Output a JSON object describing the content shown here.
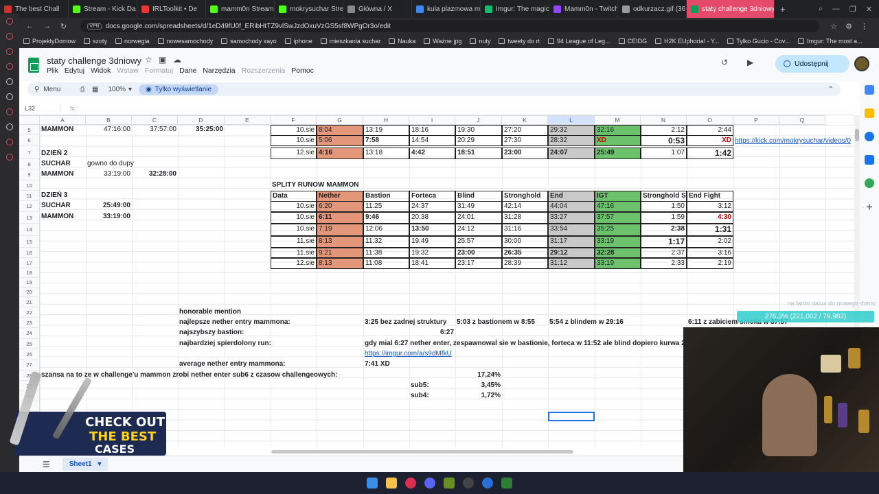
{
  "browser": {
    "tabs": [
      {
        "label": "The best Chall",
        "color": "#c33"
      },
      {
        "label": "Stream - Kick Da",
        "color": "#53fc18"
      },
      {
        "label": "IRLToolkit • De",
        "color": "#e33"
      },
      {
        "label": "mamm0n Stream",
        "color": "#53fc18"
      },
      {
        "label": "mokrysuchar Stre",
        "color": "#53fc18"
      },
      {
        "label": "Główna / X",
        "color": "#888"
      },
      {
        "label": "kula plazmowa m",
        "color": "#4285f4"
      },
      {
        "label": "Imgur: The magic",
        "color": "#1bb76e"
      },
      {
        "label": "Mamm0n - Twitch",
        "color": "#9146ff"
      },
      {
        "label": "odkurzacz.gif (36",
        "color": "#999"
      },
      {
        "label": "staty challenge 3dniowy",
        "color": "#0f9d58",
        "active": true
      }
    ],
    "new_tab": "+",
    "vpn": "VPN",
    "url": "docs.google.com/spreadsheets/d/1eD49fU0f_ERibHtTZ9vlSwJzdOxuVzGS5sf8WPgOr3o/edit",
    "bookmarks": [
      "ProjektyDomow",
      "szoty",
      "norwegia",
      "nowesamochody",
      "samochody xayo",
      "iphone",
      "mieszkania suchar",
      "Nauka",
      "Ważne jpg",
      "nuty",
      "tweety do rt",
      "94 League of Leg...",
      "CEIDG",
      "H2K EUphoria! - Y...",
      "Tylko Gucio - Cov...",
      "Imgur: The most a..."
    ]
  },
  "doc": {
    "title": "staty challenge 3dniowy",
    "menus": [
      "Plik",
      "Edytuj",
      "Widok",
      "Wstaw",
      "Formatuj",
      "Dane",
      "Narzędzia",
      "Rozszerzenia",
      "Pomoc"
    ],
    "menus_disabled": [
      "Wstaw",
      "Formatuj",
      "Rozszerzenia"
    ],
    "share": "Udostępnij",
    "search_menu": "Menu",
    "zoom": "100%",
    "view_only": "Tylko wyświetlanie",
    "cell_ref": "L32",
    "fx": "fx",
    "sheet_tab": "Sheet1"
  },
  "columns": [
    "A",
    "B",
    "C",
    "D",
    "E",
    "F",
    "G",
    "H",
    "I",
    "J",
    "K",
    "L",
    "M",
    "N",
    "O",
    "P",
    "Q"
  ],
  "rows": [
    5,
    6,
    7,
    8,
    9,
    10,
    11,
    12,
    13,
    14,
    15,
    16,
    17,
    18,
    19,
    20,
    21,
    22,
    23,
    24,
    25,
    26,
    27,
    28,
    29,
    30
  ],
  "left": {
    "r5": [
      "MAMMON",
      "47:16:00",
      "37:57:00",
      "35:25:00"
    ],
    "r7": "DZIEŃ 2",
    "r8": [
      "SUCHAR",
      "gowno do dupy"
    ],
    "r9": [
      "MAMMON",
      "33:19:00",
      "32:28:00"
    ],
    "r11": "DZIEŃ 3",
    "r12": [
      "SUCHAR",
      "25:49:00"
    ],
    "r13": [
      "MAMMON",
      "33:19:00"
    ]
  },
  "top_table": [
    [
      "10.sie",
      "8:04",
      "13:19",
      "18:16",
      "19:30",
      "27:20",
      "29:32",
      "32:16",
      "2:12",
      "2:44"
    ],
    [
      "10.sie",
      "5:06",
      "7:58",
      "14:54",
      "20:29",
      "27:30",
      "28:32",
      "XD",
      "0:53",
      "XD"
    ],
    [
      "12.sie",
      "4:16",
      "13:18",
      "4:42",
      "18:51",
      "23:00",
      "24:07",
      "25:49",
      "1:07",
      "1:42"
    ]
  ],
  "top_link": "https://kick.com/mokrysuchar/videos/0",
  "splits_title": "SPLITY RUNOW MAMMON",
  "splits_headers": [
    "Data",
    "Nether",
    "Bastion",
    "Forteca",
    "Blind",
    "Stronghold",
    "End",
    "IGT",
    "Stronghold Sp",
    "End Fight"
  ],
  "splits": [
    [
      "10.sie",
      "6:20",
      "11:25",
      "24:37",
      "31:49",
      "42:14",
      "44:04",
      "47:16",
      "1:50",
      "3:12"
    ],
    [
      "10.sie",
      "6:11",
      "9:46",
      "20:38",
      "24:01",
      "31:28",
      "33:27",
      "37:57",
      "1:59",
      "4:30"
    ],
    [
      "10.sie",
      "7:19",
      "12:06",
      "13:50",
      "24:12",
      "31:16",
      "33:54",
      "35:25",
      "2:38",
      "1:31"
    ],
    [
      "11.sie",
      "8:13",
      "11:32",
      "19:49",
      "25:57",
      "30:00",
      "31:17",
      "33:19",
      "1:17",
      "2:02"
    ],
    [
      "11.sie",
      "9:21",
      "11:38",
      "19:32",
      "23:00",
      "26:35",
      "29:12",
      "32:28",
      "2:37",
      "3:16"
    ],
    [
      "12.sie",
      "8:13",
      "11:08",
      "18:41",
      "23:17",
      "28:39",
      "31:12",
      "33:19",
      "2:33",
      "2:19"
    ]
  ],
  "notes": {
    "honorable": "honorable mention",
    "best_nether_label": "najlepsze nether entry mammona:",
    "best_nether_1": "3:25 bez zadnej struktury",
    "best_nether_2": "5:03 z bastionem w 8:55",
    "best_nether_3": "5:54 z blindem w 29:16",
    "best_nether_4": "6:11 z zabiciem smoka w 37:57",
    "fastest_bastion_label": "najszybszy bastion:",
    "fastest_bastion": "6:27",
    "worst_run_label": "najbardziej spierdolony run:",
    "worst_run": "gdy mial 6:27 nether enter, zespawnowal sie w bastionie, forteca w 11:52 ale blind dopiero kurwa 22:",
    "worst_link": "https://imgur.com/a/s9dMfkU",
    "avg_label": "average nether entry mammona:",
    "avg": "7:41 XD",
    "chance_label": "szansa na to ze w challenge'u mammon zrobi nether enter sub6 z czasow challengeowych:",
    "chance": "17,24%",
    "sub5_label": "sub5:",
    "sub5": "3,45%",
    "sub4_label": "sub4:",
    "sub4": "1,72%"
  },
  "stream": {
    "overlay_text": "na fardo dalux do nowego domu",
    "goal": "276,3% (221,002 / 79,982)",
    "ad_line1": "CHECK OUT",
    "ad_line2": "THE BEST",
    "ad_line3": "CASES"
  }
}
